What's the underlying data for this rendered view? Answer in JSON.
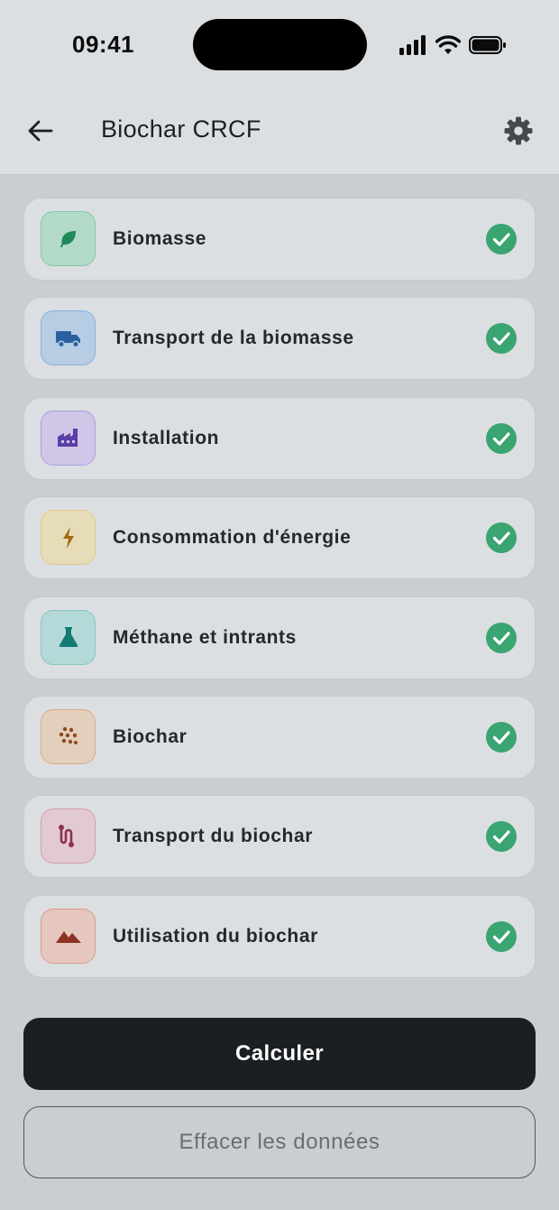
{
  "status_bar": {
    "time": "09:41"
  },
  "header": {
    "title": "Biochar CRCF"
  },
  "steps": [
    {
      "label": "Biomasse",
      "icon": "leaf-icon",
      "bg": "#b3d9c8",
      "border": "#82c7a6",
      "fg": "#1f8a5a",
      "done": true
    },
    {
      "label": "Transport de la biomasse",
      "icon": "truck-icon",
      "bg": "#b7cde3",
      "border": "#87b2de",
      "fg": "#2b5f9e",
      "done": true
    },
    {
      "label": "Installation",
      "icon": "factory-icon",
      "bg": "#cfc6e8",
      "border": "#ad9fe2",
      "fg": "#5b3fa6",
      "done": true
    },
    {
      "label": "Consommation d'énergie",
      "icon": "lightning-icon",
      "bg": "#e6dcb8",
      "border": "#ddc98a",
      "fg": "#a06a10",
      "done": true
    },
    {
      "label": "Méthane et intrants",
      "icon": "flask-icon",
      "bg": "#b5d9d8",
      "border": "#86c6c3",
      "fg": "#137a72",
      "done": true
    },
    {
      "label": "Biochar",
      "icon": "granules-icon",
      "bg": "#e3cfbd",
      "border": "#d9a98a",
      "fg": "#8a4a1e",
      "done": true
    },
    {
      "label": "Transport du biochar",
      "icon": "route-icon",
      "bg": "#e1cad1",
      "border": "#d49fb0",
      "fg": "#8e2f4c",
      "done": true
    },
    {
      "label": "Utilisation du biochar",
      "icon": "mountains-icon",
      "bg": "#e6c7bf",
      "border": "#d99a8a",
      "fg": "#8e3323",
      "done": true
    }
  ],
  "actions": {
    "primary_label": "Calculer",
    "secondary_label": "Effacer les données"
  },
  "colors": {
    "check": "#3aa571",
    "primary": "#1c1f22"
  }
}
